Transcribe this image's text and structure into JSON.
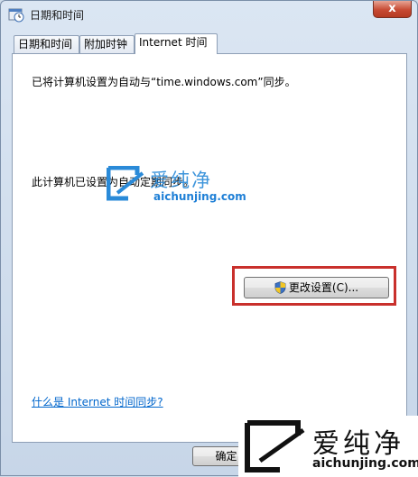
{
  "window": {
    "title": "日期和时间",
    "close_label": "x"
  },
  "tabs": [
    {
      "label": "日期和时间"
    },
    {
      "label": "附加时钟"
    },
    {
      "label": "Internet 时间"
    }
  ],
  "panel": {
    "sync_text": "已将计算机设置为自动与“time.windows.com”同步。",
    "schedule_text": "此计算机已设置为自动定期同步。",
    "change_button": "更改设置(C)...",
    "help_link": "什么是 Internet 时间同步?"
  },
  "footer": {
    "ok_button": "确定"
  },
  "watermark": {
    "cn": "爱纯净",
    "en": "aichunjing.com"
  },
  "colors": {
    "highlight": "#c9302c",
    "link": "#0066cc",
    "accent": "#2a8ad8"
  }
}
